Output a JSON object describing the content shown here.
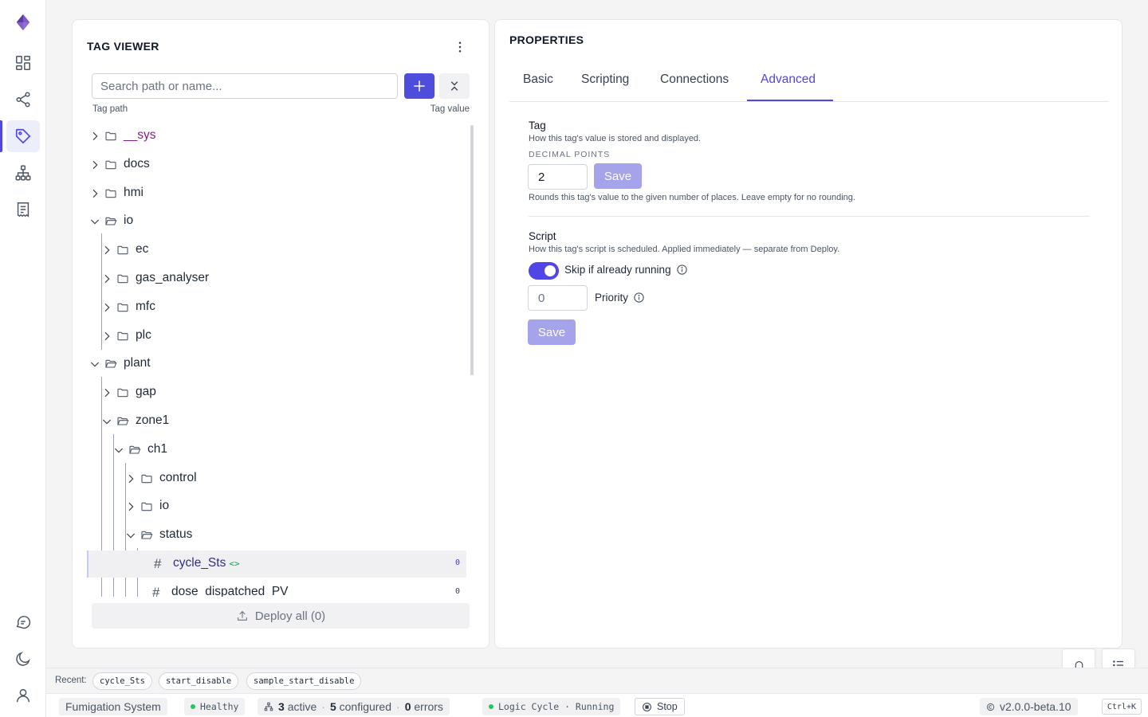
{
  "nav": {
    "logo": "logo-icon",
    "items": [
      {
        "icon": "dashboard-icon"
      },
      {
        "icon": "share-icon"
      },
      {
        "icon": "tag-icon",
        "active": true
      },
      {
        "icon": "hierarchy-icon"
      },
      {
        "icon": "receipt-icon"
      }
    ],
    "bottom": [
      {
        "icon": "chat-icon"
      },
      {
        "icon": "moon-icon"
      },
      {
        "icon": "user-icon"
      }
    ]
  },
  "tag_viewer": {
    "title": "TAG VIEWER",
    "search_placeholder": "Search path or name...",
    "col_path": "Tag path",
    "col_value": "Tag value",
    "tree": [
      {
        "label": "__sys",
        "depth": 0,
        "type": "folder",
        "expanded": false,
        "highlight": true
      },
      {
        "label": "docs",
        "depth": 0,
        "type": "folder",
        "expanded": false
      },
      {
        "label": "hmi",
        "depth": 0,
        "type": "folder",
        "expanded": false
      },
      {
        "label": "io",
        "depth": 0,
        "type": "folder",
        "expanded": true
      },
      {
        "label": "ec",
        "depth": 1,
        "type": "folder",
        "expanded": false
      },
      {
        "label": "gas_analyser",
        "depth": 1,
        "type": "folder",
        "expanded": false
      },
      {
        "label": "mfc",
        "depth": 1,
        "type": "folder",
        "expanded": false
      },
      {
        "label": "plc",
        "depth": 1,
        "type": "folder",
        "expanded": false
      },
      {
        "label": "plant",
        "depth": 0,
        "type": "folder",
        "expanded": true
      },
      {
        "label": "gap",
        "depth": 1,
        "type": "folder",
        "expanded": false
      },
      {
        "label": "zone1",
        "depth": 1,
        "type": "folder",
        "expanded": true
      },
      {
        "label": "ch1",
        "depth": 2,
        "type": "folder",
        "expanded": true
      },
      {
        "label": "control",
        "depth": 3,
        "type": "folder",
        "expanded": false
      },
      {
        "label": "io",
        "depth": 3,
        "type": "folder",
        "expanded": false
      },
      {
        "label": "status",
        "depth": 3,
        "type": "folder",
        "expanded": true
      },
      {
        "label": "cycle_Sts",
        "depth": 4,
        "type": "tag",
        "value": "0",
        "selected": true,
        "scripted": true
      },
      {
        "label": "dose_dispatched_PV",
        "depth": 4,
        "type": "tag",
        "value": "0"
      }
    ],
    "deploy_label": "Deploy all (0)"
  },
  "properties": {
    "title": "PROPERTIES",
    "tabs": [
      "Basic",
      "Scripting",
      "Connections",
      "Advanced"
    ],
    "active_tab": "Advanced",
    "tag_section": {
      "title": "Tag",
      "desc": "How this tag's value is stored and displayed.",
      "decimal_label": "DECIMAL POINTS",
      "decimal_value": "2",
      "save_label": "Save",
      "hint": "Rounds this tag's value to the given number of places. Leave empty for no rounding."
    },
    "script_section": {
      "title": "Script",
      "desc": "How this tag's script is scheduled. Applied immediately — separate from Deploy.",
      "skip_label": "Skip if already running",
      "skip_on": true,
      "priority_placeholder": "0",
      "priority_label": "Priority",
      "save_label": "Save"
    }
  },
  "recent": {
    "label": "Recent:",
    "items": [
      "cycle_Sts",
      "start_disable",
      "sample_start_disable"
    ]
  },
  "status": {
    "system": "Fumigation System",
    "health": "Healthy",
    "active_count": "3",
    "active_label": "active",
    "configured_count": "5",
    "configured_label": "configured",
    "errors_count": "0",
    "errors_label": "errors",
    "logic": "Logic Cycle · Running",
    "stop_label": "Stop",
    "version": "v2.0.0-beta.10",
    "shortcut": "Ctrl+K"
  },
  "colors": {
    "accent": "#4f46e5",
    "healthy": "#22c55e",
    "sys_folder": "#7e1e8a"
  }
}
